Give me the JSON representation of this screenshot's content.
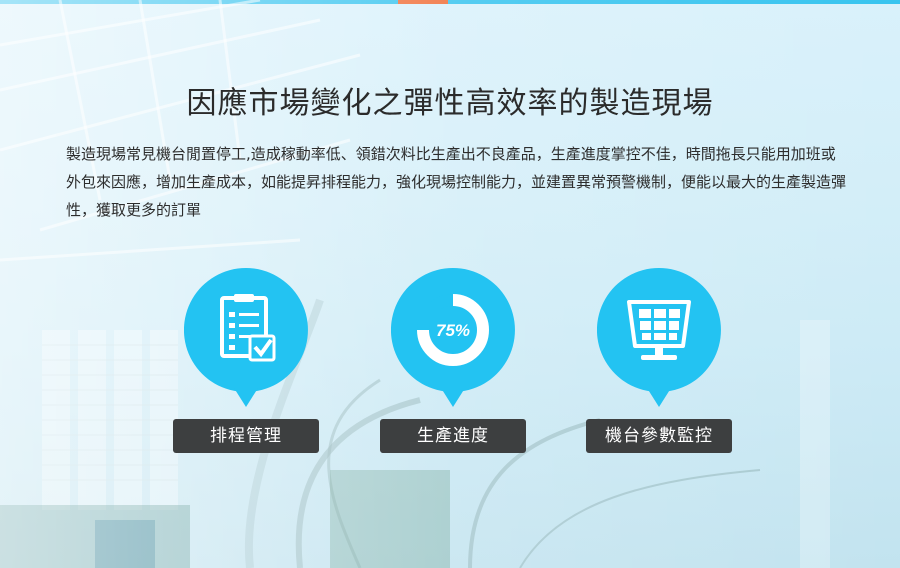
{
  "title": "因應市場變化之彈性高效率的製造現場",
  "description": "製造現場常見機台閒置停工,造成稼動率低、領錯次料比生產出不良產品，生產進度掌控不佳，時間拖長只能用加班或外包來因應，增加生產成本，如能提昇排程能力，強化現場控制能力，並建置異常預警機制，便能以最大的生產製造彈性，獲取更多的訂單",
  "features": [
    {
      "icon": "clipboard-checklist-icon",
      "label": "排程管理"
    },
    {
      "icon": "progress-donut-icon",
      "label": "生產進度",
      "progress_text": "75%",
      "progress_value": 0.75
    },
    {
      "icon": "monitor-panel-icon",
      "label": "機台參數監控"
    }
  ],
  "colors": {
    "accent": "#23c3f2",
    "label_bg": "#3d3f40",
    "top_bar": "#38c4ef",
    "top_tab": "#f06f3a"
  }
}
